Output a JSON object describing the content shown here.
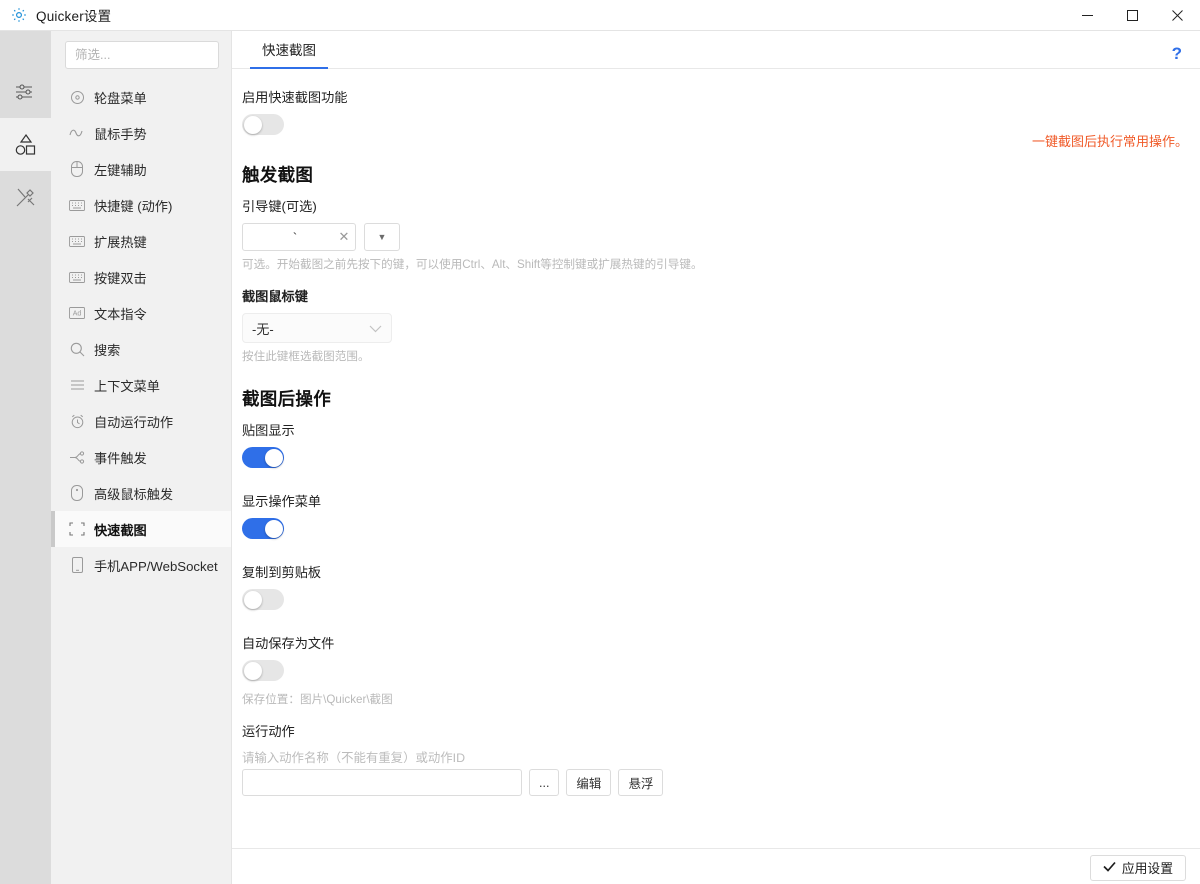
{
  "window": {
    "title": "Quicker设置",
    "app_icon": "gear-icon",
    "controls": {
      "minimize": "—",
      "maximize": "□",
      "close": "✕"
    }
  },
  "rail": {
    "items": [
      {
        "icon": "sliders-icon",
        "name": "general-settings",
        "active": false
      },
      {
        "icon": "shapes-icon",
        "name": "triggers",
        "active": true
      },
      {
        "icon": "tools-icon",
        "name": "tools",
        "active": false
      }
    ]
  },
  "sidebar": {
    "filter_placeholder": "筛选...",
    "filter_value": "",
    "items": [
      {
        "label": "轮盘菜单",
        "icon": "circle-dot-icon",
        "selected": false
      },
      {
        "label": "鼠标手势",
        "icon": "gesture-wave-icon",
        "selected": false
      },
      {
        "label": "左键辅助",
        "icon": "mouse-icon",
        "selected": false
      },
      {
        "label": "快捷键 (动作)",
        "icon": "keyboard-icon",
        "selected": false
      },
      {
        "label": "扩展热键",
        "icon": "keyboard-icon",
        "selected": false
      },
      {
        "label": "按键双击",
        "icon": "keyboard-icon",
        "selected": false
      },
      {
        "label": "文本指令",
        "icon": "ad-text-icon",
        "selected": false
      },
      {
        "label": "搜索",
        "icon": "search-icon",
        "selected": false
      },
      {
        "label": "上下文菜单",
        "icon": "menu-lines-icon",
        "selected": false
      },
      {
        "label": "自动运行动作",
        "icon": "alarm-clock-icon",
        "selected": false
      },
      {
        "label": "事件触发",
        "icon": "event-branch-icon",
        "selected": false
      },
      {
        "label": "高级鼠标触发",
        "icon": "mouse-advanced-icon",
        "selected": false
      },
      {
        "label": "快速截图",
        "icon": "crop-brackets-icon",
        "selected": true
      },
      {
        "label": "手机APP/WebSocket",
        "icon": "phone-icon",
        "selected": false
      }
    ]
  },
  "main": {
    "tabs": [
      {
        "label": "快速截图",
        "active": true
      }
    ],
    "help_icon": "?",
    "orange_note": "一键截图后执行常用操作。",
    "enable": {
      "label": "启用快速截图功能",
      "toggle_on": false
    },
    "trigger_section": {
      "title": "触发截图",
      "guide_key": {
        "label": "引导键(可选)",
        "value": "`",
        "clear_icon": "✕",
        "dropdown_icon": "▼",
        "hint": "可选。开始截图之前先按下的键，可以使用Ctrl、Alt、Shift等控制键或扩展热键的引导键。"
      },
      "mouse_key": {
        "label": "截图鼠标键",
        "selected": "-无-",
        "hint": "按住此键框选截图范围。"
      }
    },
    "post_section": {
      "title": "截图后操作",
      "options": [
        {
          "label": "贴图显示",
          "toggle_on": true
        },
        {
          "label": "显示操作菜单",
          "toggle_on": true
        },
        {
          "label": "复制到剪贴板",
          "toggle_on": false
        },
        {
          "label": "自动保存为文件",
          "toggle_on": false
        }
      ],
      "save_path_hint": "保存位置：图片\\Quicker\\截图",
      "run_action": {
        "label": "运行动作",
        "input_placeholder": "请输入动作名称（不能有重复）或动作ID",
        "input_value": "",
        "browse_label": "...",
        "edit_label": "编辑",
        "float_label": "悬浮"
      }
    }
  },
  "footer": {
    "apply_label": "应用设置",
    "apply_icon": "check-icon"
  },
  "colors": {
    "accent_blue": "#2f6fe8",
    "orange": "#f05a28",
    "rail_bg": "#dcdcdc",
    "nav_bg": "#f1f1f1"
  }
}
